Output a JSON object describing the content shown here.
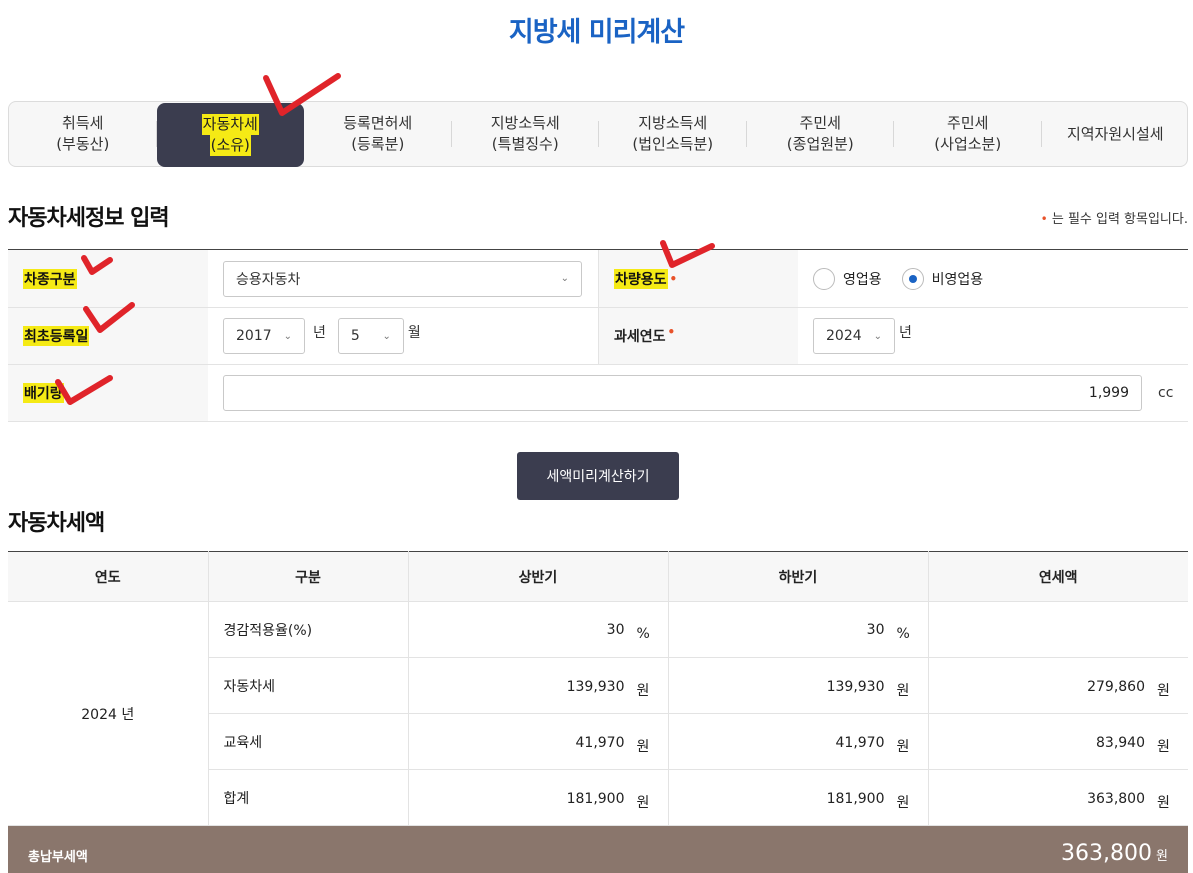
{
  "title": "지방세 미리계산",
  "tabs": [
    {
      "line1": "취득세",
      "line2": "(부동산)"
    },
    {
      "line1": "자동차세",
      "line2": "(소유)"
    },
    {
      "line1": "등록면허세",
      "line2": "(등록분)"
    },
    {
      "line1": "지방소득세",
      "line2": "(특별징수)"
    },
    {
      "line1": "지방소득세",
      "line2": "(법인소득분)"
    },
    {
      "line1": "주민세",
      "line2": "(종업원분)"
    },
    {
      "line1": "주민세",
      "line2": "(사업소분)"
    },
    {
      "line1": "지역자원시설세",
      "line2": ""
    }
  ],
  "form": {
    "title": "자동차세정보 입력",
    "required_dot": "•",
    "required_note": "는 필수 입력 항목입니다.",
    "vehicle_type_label": "차종구분",
    "vehicle_type_value": "승용자동차",
    "vehicle_use_label": "차량용도",
    "use_options": [
      "영업용",
      "비영업용"
    ],
    "first_reg_label": "최초등록일",
    "reg_year": "2017",
    "reg_year_unit": "년",
    "reg_month": "5",
    "reg_month_unit": "월",
    "tax_year_label": "과세연도",
    "tax_year": "2024",
    "tax_year_unit": "년",
    "displacement_label": "배기량",
    "displacement_value": "1,999",
    "displacement_unit": "cc",
    "calc_button": "세액미리계산하기"
  },
  "result": {
    "title": "자동차세액",
    "headers": [
      "연도",
      "구분",
      "상반기",
      "하반기",
      "연세액"
    ],
    "year": "2024 년",
    "rows": [
      {
        "label": "경감적용율(%)",
        "h1": "30",
        "h1u": "%",
        "h2": "30",
        "h2u": "%",
        "yr": "",
        "yru": ""
      },
      {
        "label": "자동차세",
        "h1": "139,930",
        "h1u": "원",
        "h2": "139,930",
        "h2u": "원",
        "yr": "279,860",
        "yru": "원"
      },
      {
        "label": "교육세",
        "h1": "41,970",
        "h1u": "원",
        "h2": "41,970",
        "h2u": "원",
        "yr": "83,940",
        "yru": "원"
      },
      {
        "label": "합계",
        "h1": "181,900",
        "h1u": "원",
        "h2": "181,900",
        "h2u": "원",
        "yr": "363,800",
        "yru": "원"
      }
    ],
    "total_label": "총납부세액",
    "total_value": "363,800",
    "total_unit": "원"
  },
  "colors": {
    "accent": "#1a63c4",
    "dark": "#3b3d4f",
    "highlight": "#f5ea15",
    "mark": "#e0242a",
    "total_bg": "#8a766c"
  }
}
